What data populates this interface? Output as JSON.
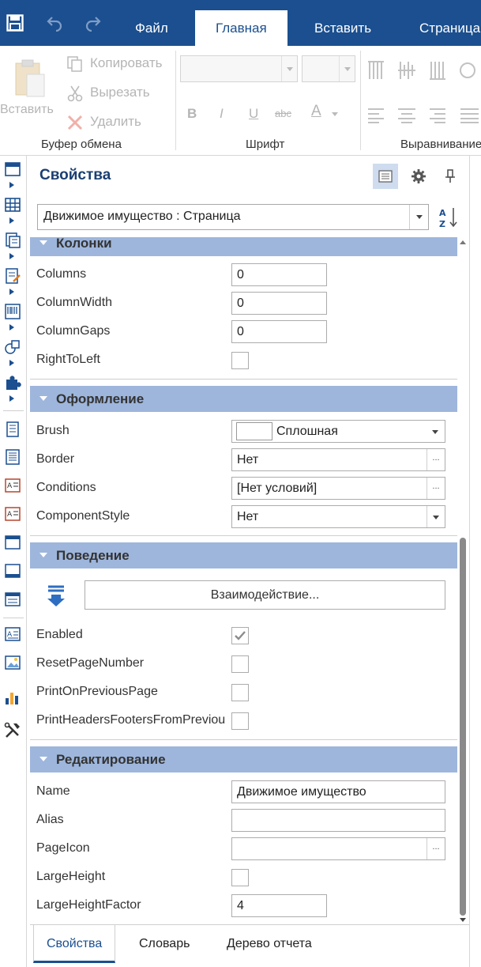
{
  "colors": {
    "accent": "#1b4f8f",
    "category_bg": "#9eb6dc",
    "panel_title": "#1b3f72"
  },
  "quick_access": [
    "save-icon",
    "undo-icon",
    "redo-icon"
  ],
  "tabs": [
    {
      "label": "Файл"
    },
    {
      "label": "Главная"
    },
    {
      "label": "Вставить"
    },
    {
      "label": "Страница"
    }
  ],
  "ribbon": {
    "clipboard": {
      "paste_label": "Вставить",
      "copy_label": "Копировать",
      "cut_label": "Вырезать",
      "delete_label": "Удалить",
      "group_label": "Буфер обмена"
    },
    "font": {
      "group_label": "Шрифт",
      "bold": "B",
      "italic": "I",
      "underline": "U",
      "strike": "abc",
      "color": "A"
    },
    "align": {
      "group_label": "Выравнивание"
    }
  },
  "panel": {
    "title": "Свойства",
    "object_selector": "Движимое имущество : Страница",
    "sort_label": "A Z"
  },
  "grid": {
    "columns": {
      "header": "Колонки",
      "props": [
        {
          "name": "Columns",
          "value": "0"
        },
        {
          "name": "ColumnWidth",
          "value": "0"
        },
        {
          "name": "ColumnGaps",
          "value": "0"
        },
        {
          "name": "RightToLeft"
        }
      ]
    },
    "appearance": {
      "header": "Оформление",
      "props": [
        {
          "name": "Brush",
          "value": "Сплошная"
        },
        {
          "name": "Border",
          "value": "Нет"
        },
        {
          "name": "Conditions",
          "value": "[Нет условий]"
        },
        {
          "name": "ComponentStyle",
          "value": "Нет"
        }
      ]
    },
    "behavior": {
      "header": "Поведение",
      "interaction_button": "Взаимодействие...",
      "props": [
        {
          "name": "Enabled",
          "checked": true
        },
        {
          "name": "ResetPageNumber",
          "checked": false
        },
        {
          "name": "PrintOnPreviousPage",
          "checked": false
        },
        {
          "name": "PrintHeadersFootersFromPrevious",
          "checked": false
        }
      ]
    },
    "editing": {
      "header": "Редактирование",
      "props": [
        {
          "name": "Name",
          "value": "Движимое имущество"
        },
        {
          "name": "Alias",
          "value": ""
        },
        {
          "name": "PageIcon",
          "value": ""
        },
        {
          "name": "LargeHeight",
          "checked": false
        },
        {
          "name": "LargeHeightFactor",
          "value": "4"
        }
      ]
    }
  },
  "bottom_tabs": [
    {
      "label": "Свойства"
    },
    {
      "label": "Словарь"
    },
    {
      "label": "Дерево отчета"
    }
  ]
}
